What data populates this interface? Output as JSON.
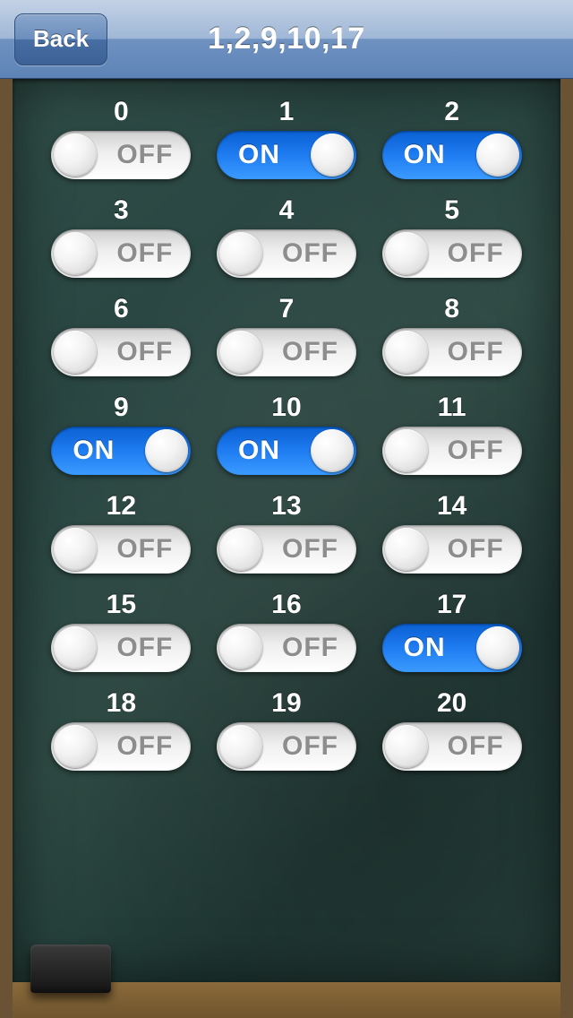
{
  "navbar": {
    "back_label": "Back",
    "title": "1,2,9,10,17"
  },
  "labels": {
    "on": "ON",
    "off": "OFF"
  },
  "switches": [
    {
      "id": "0",
      "state": "off"
    },
    {
      "id": "1",
      "state": "on"
    },
    {
      "id": "2",
      "state": "on"
    },
    {
      "id": "3",
      "state": "off"
    },
    {
      "id": "4",
      "state": "off"
    },
    {
      "id": "5",
      "state": "off"
    },
    {
      "id": "6",
      "state": "off"
    },
    {
      "id": "7",
      "state": "off"
    },
    {
      "id": "8",
      "state": "off"
    },
    {
      "id": "9",
      "state": "on"
    },
    {
      "id": "10",
      "state": "on"
    },
    {
      "id": "11",
      "state": "off"
    },
    {
      "id": "12",
      "state": "off"
    },
    {
      "id": "13",
      "state": "off"
    },
    {
      "id": "14",
      "state": "off"
    },
    {
      "id": "15",
      "state": "off"
    },
    {
      "id": "16",
      "state": "off"
    },
    {
      "id": "17",
      "state": "on"
    },
    {
      "id": "18",
      "state": "off"
    },
    {
      "id": "19",
      "state": "off"
    },
    {
      "id": "20",
      "state": "off"
    }
  ]
}
